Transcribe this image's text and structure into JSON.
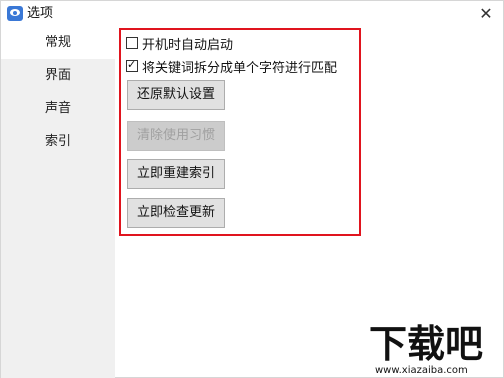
{
  "window": {
    "title": "选项",
    "close_glyph": "✕",
    "app_icon": "app-eye-icon"
  },
  "sidebar": {
    "items": [
      {
        "label": "常规",
        "active": true
      },
      {
        "label": "界面",
        "active": false
      },
      {
        "label": "声音",
        "active": false
      },
      {
        "label": "索引",
        "active": false
      }
    ]
  },
  "general": {
    "options": [
      {
        "label": "开机时自动启动",
        "checked": false
      },
      {
        "label": "将关键词拆分成单个字符进行匹配",
        "checked": true
      }
    ],
    "buttons": [
      {
        "label": "还原默认设置",
        "enabled": true
      },
      {
        "label": "清除使用习惯",
        "enabled": false
      },
      {
        "label": "立即重建索引",
        "enabled": true
      },
      {
        "label": "立即检查更新",
        "enabled": true
      }
    ]
  },
  "watermark": {
    "text": "下载吧",
    "url": "www.xiazaiba.com"
  },
  "colors": {
    "highlight_border": "#e0141e",
    "sidebar_bg": "#f0f0f0",
    "button_bg": "#e1e1e1"
  }
}
